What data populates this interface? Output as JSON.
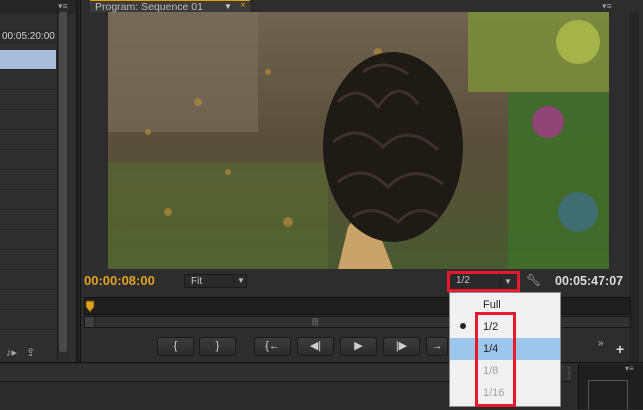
{
  "left_panel": {
    "timecode": "00:05:20:00"
  },
  "monitor": {
    "tab_title": "Program: Sequence 01",
    "current_timecode": "00:00:08:00",
    "zoom_value": "Fit",
    "resolution_value": "1/2",
    "duration_timecode": "00:05:47:07",
    "transport_buttons": [
      {
        "icon": "mark-in-icon",
        "glyph": "{"
      },
      {
        "icon": "mark-out-icon",
        "glyph": "}"
      },
      {
        "icon": "go-to-in-icon",
        "glyph": "{←"
      },
      {
        "icon": "step-back-icon",
        "glyph": "◀|"
      },
      {
        "icon": "play-icon",
        "glyph": "▶"
      },
      {
        "icon": "step-forward-icon",
        "glyph": "|▶"
      },
      {
        "icon": "go-to-out-icon",
        "glyph": "→"
      }
    ]
  },
  "resolution_menu": {
    "options": [
      {
        "label": "Full",
        "state": "enabled"
      },
      {
        "label": "1/2",
        "state": "checked"
      },
      {
        "label": "1/4",
        "state": "highlighted"
      },
      {
        "label": "1/8",
        "state": "disabled"
      },
      {
        "label": "1/16",
        "state": "disabled"
      }
    ]
  },
  "colors": {
    "accent_timecode": "#e1a21f",
    "annotation_red": "#e8192c",
    "menu_highlight": "#9cc6ec"
  }
}
